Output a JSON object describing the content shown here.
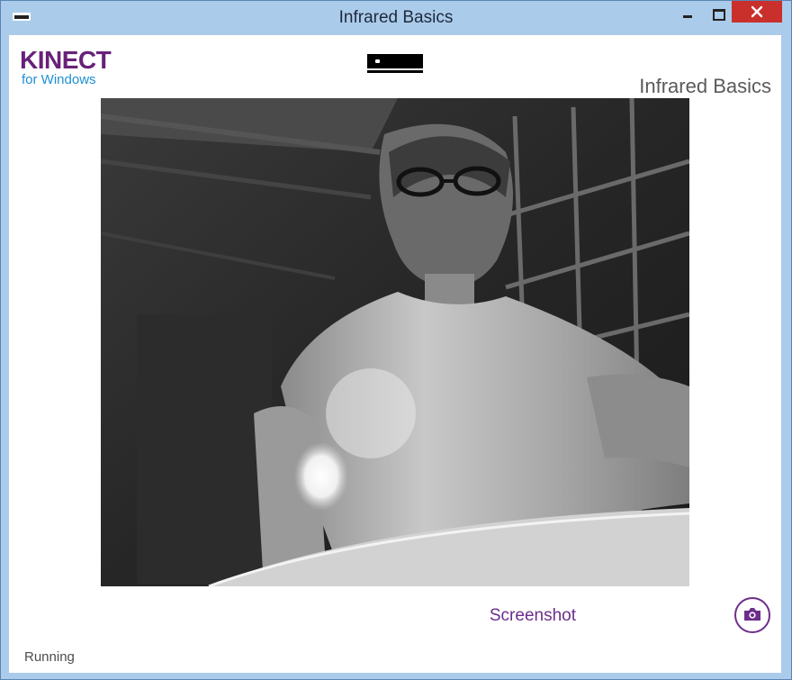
{
  "window": {
    "title": "Infrared Basics"
  },
  "header": {
    "logo_main": "KINECT",
    "logo_sub": "for Windows",
    "app_title": "Infrared Basics",
    "sensor_icon": "kinect-sensor-icon"
  },
  "main": {
    "feed_description_icon": "infrared-camera-feed"
  },
  "footer": {
    "screenshot_label": "Screenshot",
    "screenshot_icon": "camera-icon",
    "status": "Running"
  },
  "colors": {
    "brand_purple": "#68217a",
    "brand_blue": "#1e8fd2",
    "close_red": "#c9302c",
    "window_frame": "#abcbeb"
  }
}
